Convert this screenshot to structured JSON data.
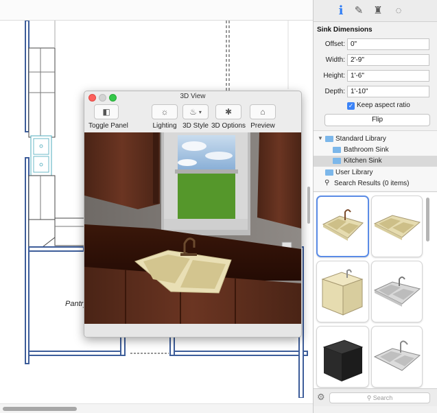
{
  "canvas": {
    "room_label": "Pantry"
  },
  "view3d": {
    "title": "3D View",
    "toolbar": {
      "toggle_panel": "Toggle Panel",
      "lighting": "Lighting",
      "style_3d": "3D Style",
      "options_3d": "3D Options",
      "preview": "Preview"
    }
  },
  "inspector": {
    "tabs": [
      {
        "name": "info-icon",
        "glyph": "i"
      },
      {
        "name": "paint-brush-icon",
        "glyph": "✎"
      },
      {
        "name": "chair-icon",
        "glyph": "♜"
      },
      {
        "name": "mouse-icon",
        "glyph": "◌"
      }
    ],
    "section_title": "Sink Dimensions",
    "fields": {
      "offset": {
        "label": "Offset:",
        "value": "0\""
      },
      "width": {
        "label": "Width:",
        "value": "2'-9\""
      },
      "height": {
        "label": "Height:",
        "value": "1'-6\""
      },
      "depth": {
        "label": "Depth:",
        "value": "1'-10\""
      }
    },
    "keep_aspect": {
      "label": "Keep aspect ratio",
      "checked": true
    },
    "flip_label": "Flip",
    "library": {
      "standard": "Standard Library",
      "bathroom": "Bathroom Sink",
      "kitchen": "Kitchen Sink",
      "user": "User Library",
      "search_results": "Search Results (0 items)"
    },
    "search_placeholder": "Search"
  },
  "colors": {
    "accent": "#3b83f7",
    "wall": "#3c5c99",
    "cabinet": "#5a2d1e",
    "countertop": "#2f1208",
    "sink": "#e9dfb5"
  }
}
